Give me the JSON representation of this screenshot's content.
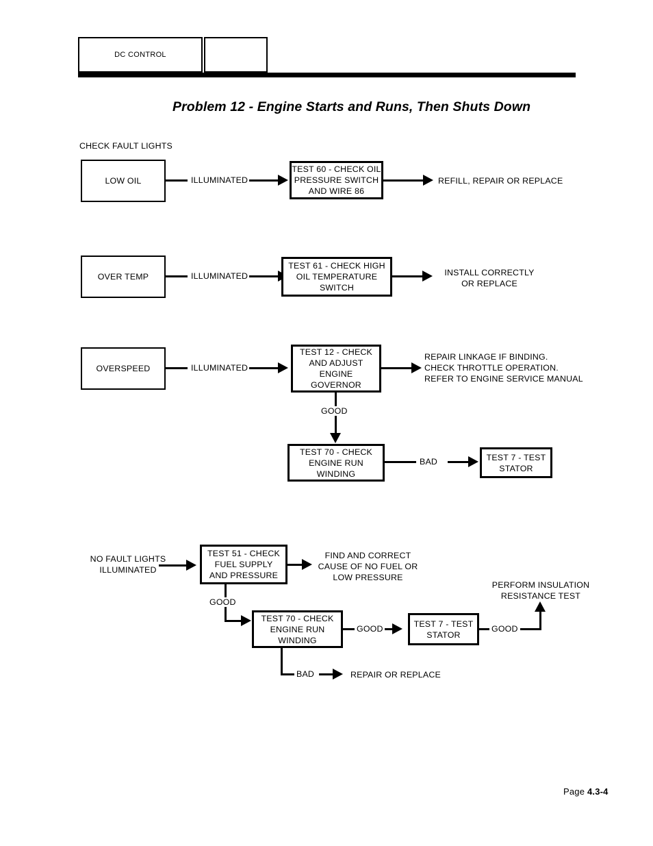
{
  "header": {
    "section_label": "DC CONTROL",
    "second_box_label": ""
  },
  "title": "Problem 12 - Engine Starts and Runs, Then Shuts Down",
  "section_labels": {
    "check_fault_lights": "CHECK FAULT LIGHTS"
  },
  "flow": {
    "row1": {
      "source": "LOW OIL",
      "connector": "ILLUMINATED",
      "test": "TEST 60 - CHECK OIL\nPRESSURE SWITCH\nAND WIRE 86",
      "outcome": "REFILL, REPAIR OR REPLACE"
    },
    "row2": {
      "source": "OVER TEMP",
      "connector": "ILLUMINATED",
      "test": "TEST 61 - CHECK HIGH\nOIL TEMPERATURE\nSWITCH",
      "outcome": "INSTALL CORRECTLY\nOR REPLACE"
    },
    "row3": {
      "source": "OVERSPEED",
      "connector": "ILLUMINATED",
      "test": "TEST 12 - CHECK\nAND ADJUST\nENGINE\nGOVERNOR",
      "outcome": "REPAIR LINKAGE IF BINDING.\nCHECK THROTTLE OPERATION.\nREFER TO ENGINE SERVICE MANUAL",
      "down_label": "GOOD",
      "test70": "TEST 70 - CHECK\nENGINE RUN\nWINDING",
      "bad_label": "BAD",
      "test7": "TEST 7 - TEST\nSTATOR"
    },
    "row4": {
      "source": "NO FAULT LIGHTS\nILLUMINATED",
      "test51": "TEST 51 - CHECK\nFUEL SUPPLY\nAND PRESSURE",
      "outcome": "FIND AND CORRECT\nCAUSE OF NO FUEL OR\nLOW PRESSURE",
      "good_label_1": "GOOD",
      "test70": "TEST 70 - CHECK\nENGINE RUN\nWINDING",
      "good_label_2": "GOOD",
      "bad_label": "BAD",
      "bad_outcome": "REPAIR OR REPLACE",
      "test7": "TEST 7 - TEST\nSTATOR",
      "good_label_3": "GOOD",
      "final_outcome": "PERFORM INSULATION\nRESISTANCE TEST"
    }
  },
  "footer": {
    "page_prefix": "Page ",
    "page_number": "4.3-4"
  }
}
